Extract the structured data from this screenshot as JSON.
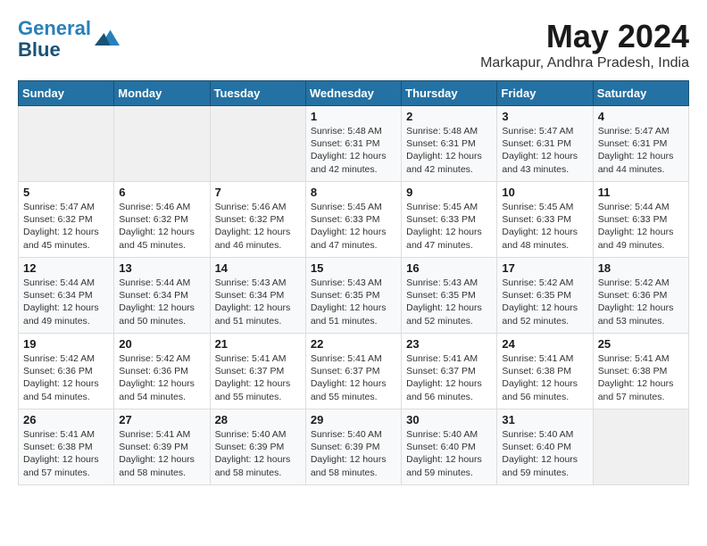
{
  "header": {
    "logo_line1": "General",
    "logo_line2": "Blue",
    "month_title": "May 2024",
    "location": "Markapur, Andhra Pradesh, India"
  },
  "weekdays": [
    "Sunday",
    "Monday",
    "Tuesday",
    "Wednesday",
    "Thursday",
    "Friday",
    "Saturday"
  ],
  "weeks": [
    [
      {
        "day": "",
        "info": ""
      },
      {
        "day": "",
        "info": ""
      },
      {
        "day": "",
        "info": ""
      },
      {
        "day": "1",
        "info": "Sunrise: 5:48 AM\nSunset: 6:31 PM\nDaylight: 12 hours\nand 42 minutes."
      },
      {
        "day": "2",
        "info": "Sunrise: 5:48 AM\nSunset: 6:31 PM\nDaylight: 12 hours\nand 42 minutes."
      },
      {
        "day": "3",
        "info": "Sunrise: 5:47 AM\nSunset: 6:31 PM\nDaylight: 12 hours\nand 43 minutes."
      },
      {
        "day": "4",
        "info": "Sunrise: 5:47 AM\nSunset: 6:31 PM\nDaylight: 12 hours\nand 44 minutes."
      }
    ],
    [
      {
        "day": "5",
        "info": "Sunrise: 5:47 AM\nSunset: 6:32 PM\nDaylight: 12 hours\nand 45 minutes."
      },
      {
        "day": "6",
        "info": "Sunrise: 5:46 AM\nSunset: 6:32 PM\nDaylight: 12 hours\nand 45 minutes."
      },
      {
        "day": "7",
        "info": "Sunrise: 5:46 AM\nSunset: 6:32 PM\nDaylight: 12 hours\nand 46 minutes."
      },
      {
        "day": "8",
        "info": "Sunrise: 5:45 AM\nSunset: 6:33 PM\nDaylight: 12 hours\nand 47 minutes."
      },
      {
        "day": "9",
        "info": "Sunrise: 5:45 AM\nSunset: 6:33 PM\nDaylight: 12 hours\nand 47 minutes."
      },
      {
        "day": "10",
        "info": "Sunrise: 5:45 AM\nSunset: 6:33 PM\nDaylight: 12 hours\nand 48 minutes."
      },
      {
        "day": "11",
        "info": "Sunrise: 5:44 AM\nSunset: 6:33 PM\nDaylight: 12 hours\nand 49 minutes."
      }
    ],
    [
      {
        "day": "12",
        "info": "Sunrise: 5:44 AM\nSunset: 6:34 PM\nDaylight: 12 hours\nand 49 minutes."
      },
      {
        "day": "13",
        "info": "Sunrise: 5:44 AM\nSunset: 6:34 PM\nDaylight: 12 hours\nand 50 minutes."
      },
      {
        "day": "14",
        "info": "Sunrise: 5:43 AM\nSunset: 6:34 PM\nDaylight: 12 hours\nand 51 minutes."
      },
      {
        "day": "15",
        "info": "Sunrise: 5:43 AM\nSunset: 6:35 PM\nDaylight: 12 hours\nand 51 minutes."
      },
      {
        "day": "16",
        "info": "Sunrise: 5:43 AM\nSunset: 6:35 PM\nDaylight: 12 hours\nand 52 minutes."
      },
      {
        "day": "17",
        "info": "Sunrise: 5:42 AM\nSunset: 6:35 PM\nDaylight: 12 hours\nand 52 minutes."
      },
      {
        "day": "18",
        "info": "Sunrise: 5:42 AM\nSunset: 6:36 PM\nDaylight: 12 hours\nand 53 minutes."
      }
    ],
    [
      {
        "day": "19",
        "info": "Sunrise: 5:42 AM\nSunset: 6:36 PM\nDaylight: 12 hours\nand 54 minutes."
      },
      {
        "day": "20",
        "info": "Sunrise: 5:42 AM\nSunset: 6:36 PM\nDaylight: 12 hours\nand 54 minutes."
      },
      {
        "day": "21",
        "info": "Sunrise: 5:41 AM\nSunset: 6:37 PM\nDaylight: 12 hours\nand 55 minutes."
      },
      {
        "day": "22",
        "info": "Sunrise: 5:41 AM\nSunset: 6:37 PM\nDaylight: 12 hours\nand 55 minutes."
      },
      {
        "day": "23",
        "info": "Sunrise: 5:41 AM\nSunset: 6:37 PM\nDaylight: 12 hours\nand 56 minutes."
      },
      {
        "day": "24",
        "info": "Sunrise: 5:41 AM\nSunset: 6:38 PM\nDaylight: 12 hours\nand 56 minutes."
      },
      {
        "day": "25",
        "info": "Sunrise: 5:41 AM\nSunset: 6:38 PM\nDaylight: 12 hours\nand 57 minutes."
      }
    ],
    [
      {
        "day": "26",
        "info": "Sunrise: 5:41 AM\nSunset: 6:38 PM\nDaylight: 12 hours\nand 57 minutes."
      },
      {
        "day": "27",
        "info": "Sunrise: 5:41 AM\nSunset: 6:39 PM\nDaylight: 12 hours\nand 58 minutes."
      },
      {
        "day": "28",
        "info": "Sunrise: 5:40 AM\nSunset: 6:39 PM\nDaylight: 12 hours\nand 58 minutes."
      },
      {
        "day": "29",
        "info": "Sunrise: 5:40 AM\nSunset: 6:39 PM\nDaylight: 12 hours\nand 58 minutes."
      },
      {
        "day": "30",
        "info": "Sunrise: 5:40 AM\nSunset: 6:40 PM\nDaylight: 12 hours\nand 59 minutes."
      },
      {
        "day": "31",
        "info": "Sunrise: 5:40 AM\nSunset: 6:40 PM\nDaylight: 12 hours\nand 59 minutes."
      },
      {
        "day": "",
        "info": ""
      }
    ]
  ]
}
